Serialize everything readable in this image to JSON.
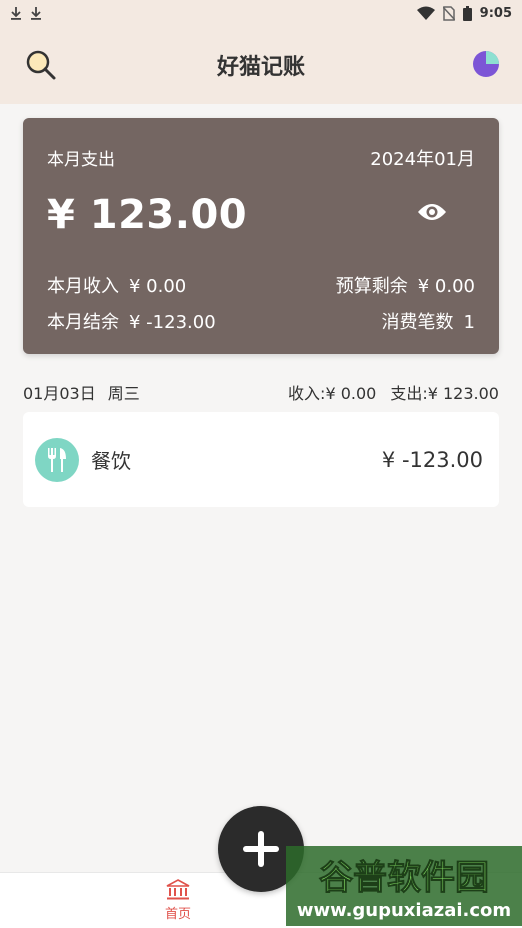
{
  "status_bar": {
    "time": "9:05"
  },
  "header": {
    "title": "好猫记账"
  },
  "summary": {
    "label": "本月支出",
    "month": "2024年01月",
    "amount": "¥ 123.00",
    "income_label": "本月收入",
    "income_value": "¥ 0.00",
    "budget_label": "预算剩余",
    "budget_value": "¥ 0.00",
    "balance_label": "本月结余",
    "balance_value": "¥ -123.00",
    "count_label": "消费笔数",
    "count_value": "1"
  },
  "day": {
    "date": "01月03日",
    "weekday": "周三",
    "income": "收入:¥ 0.00",
    "expense": "支出:¥ 123.00"
  },
  "records": [
    {
      "icon": "fork-knife-icon",
      "category": "餐饮",
      "amount": "¥ -123.00"
    }
  ],
  "bottom_nav": {
    "home_label": "首页"
  },
  "watermark": {
    "brand": "谷普软件园",
    "url": "www.gupuxiazai.com"
  },
  "colors": {
    "header_bg": "#f3e9e1",
    "card_bg": "#746662",
    "category_icon_bg": "#7fd6c4",
    "nav_active": "#e0524b",
    "fab_bg": "#2b2b2b"
  }
}
